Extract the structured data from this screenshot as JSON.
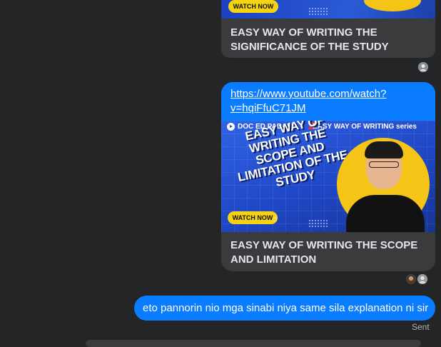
{
  "colors": {
    "background": "#242526",
    "bubble_blue": "#0a7cff",
    "card_gray": "#3a3b3c",
    "thumb_yellow": "#f5d312"
  },
  "messages": [
    {
      "type": "shared-link-card",
      "card_title": "EASY WAY OF WRITING THE SIGNIFICANCE OF THE STUDY",
      "thumb_button": "WATCH NOW"
    },
    {
      "type": "shared-link-card",
      "url_text": "https://www.youtube.com/watch?v=hqiFfuC71JM",
      "thumbnail": {
        "channel": "DOC ED PADAMA",
        "series": "EASY WAY OF WRITING series",
        "headline": "EASY WAY OF WRITING THE SCOPE AND LIMITATION OF THE STUDY",
        "button": "WATCH NOW"
      },
      "card_title": "EASY WAY OF WRITING THE SCOPE AND LIMITATION"
    },
    {
      "type": "text",
      "text": "eto pannorin nio mga sinabi niya same sila explanation ni sir",
      "status": "Sent"
    }
  ]
}
